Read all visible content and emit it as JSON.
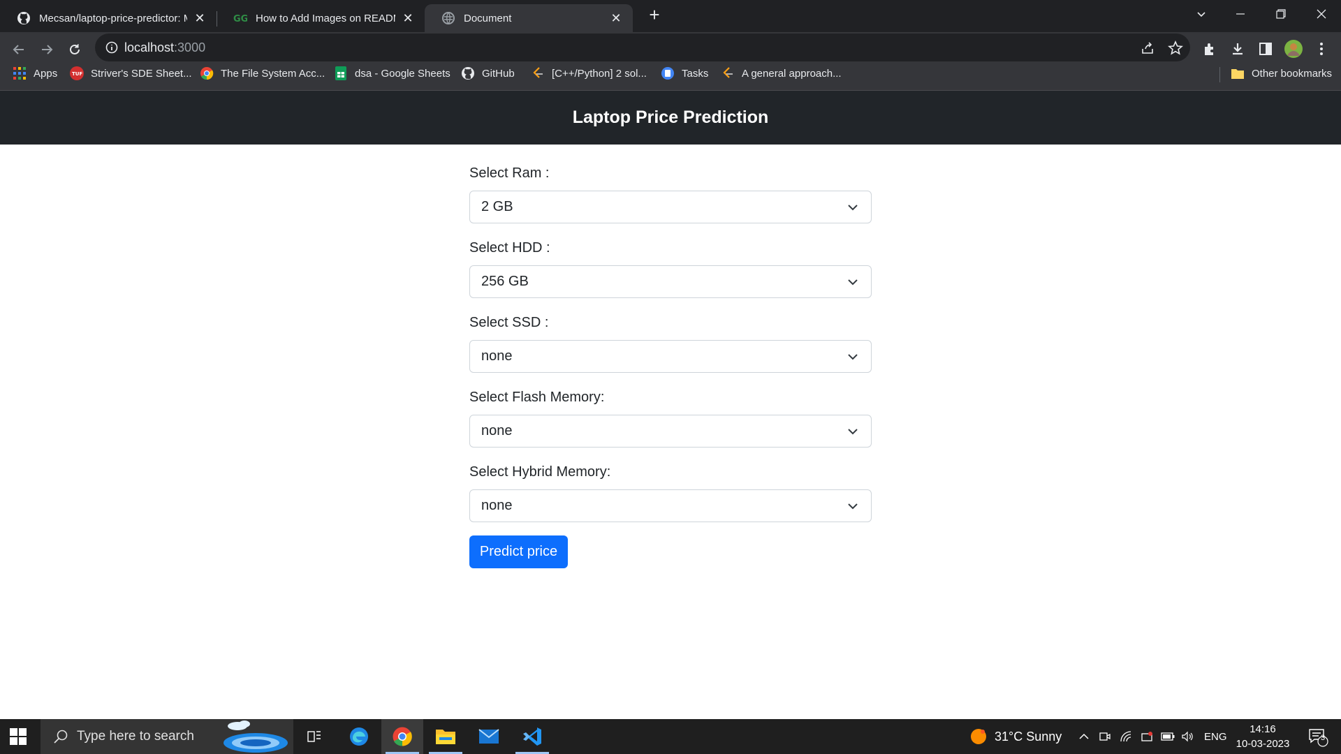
{
  "browser": {
    "tabs": [
      {
        "title": "Mecsan/laptop-price-predictor: M",
        "icon": "github-icon"
      },
      {
        "title": "How to Add Images on README",
        "icon": "geeksforgeeks-icon"
      },
      {
        "title": "Document",
        "icon": "globe-icon",
        "active": true
      }
    ],
    "new_tab_label": "+",
    "url_host": "localhost",
    "url_port": ":3000",
    "bookmarks": [
      {
        "label": "Apps",
        "icon": "apps-grid-icon"
      },
      {
        "label": "Striver's SDE Sheet...",
        "icon": "tuf-icon"
      },
      {
        "label": "The File System Acc...",
        "icon": "chrome-icon"
      },
      {
        "label": "dsa - Google Sheets",
        "icon": "sheets-icon"
      },
      {
        "label": "GitHub",
        "icon": "github-icon"
      },
      {
        "label": "[C++/Python] 2 sol...",
        "icon": "leetcode-icon"
      },
      {
        "label": "Tasks",
        "icon": "tasks-icon"
      },
      {
        "label": "A general approach...",
        "icon": "leetcode-icon"
      }
    ],
    "other_bookmarks": "Other bookmarks"
  },
  "page": {
    "title": "Laptop Price Prediction",
    "fields": [
      {
        "label": "Select Ram :",
        "value": "2 GB"
      },
      {
        "label": "Select HDD :",
        "value": "256 GB"
      },
      {
        "label": "Select SSD :",
        "value": "none"
      },
      {
        "label": "Select Flash Memory:",
        "value": "none"
      },
      {
        "label": "Select Hybrid Memory:",
        "value": "none"
      }
    ],
    "submit_label": "Predict price",
    "colors": {
      "navbar": "#212529",
      "primary": "#0d6efd"
    }
  },
  "taskbar": {
    "search_placeholder": "Type here to search",
    "weather": "31°C  Sunny",
    "language": "ENG",
    "time": "14:16",
    "date": "10-03-2023",
    "notification_count": "3"
  }
}
